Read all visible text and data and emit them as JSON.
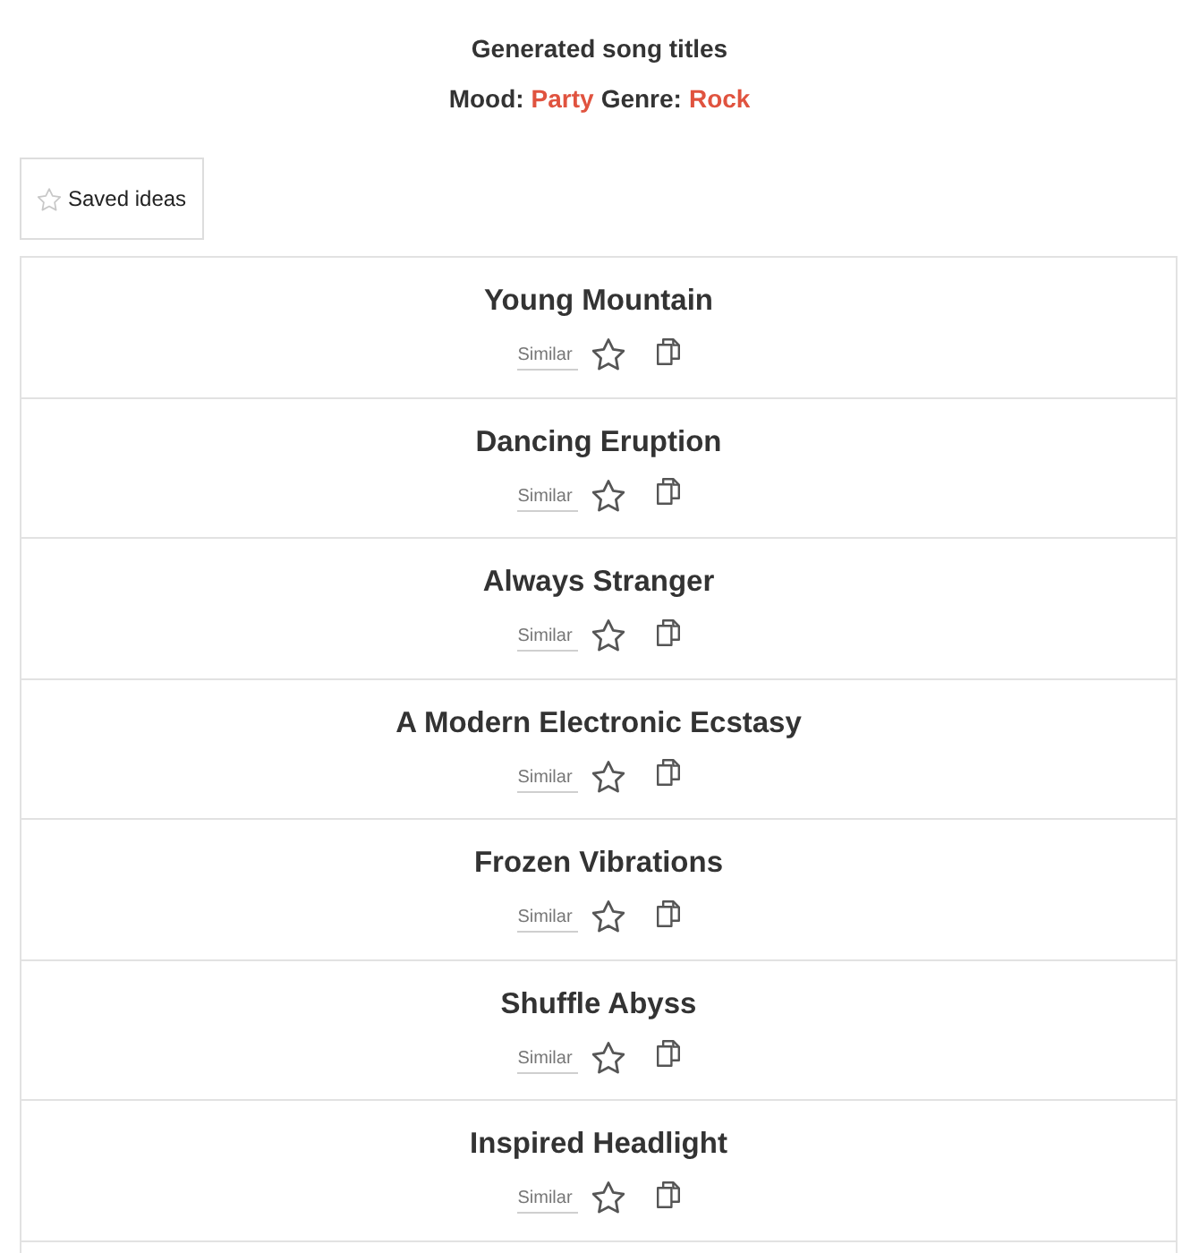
{
  "header": {
    "title": "Generated song titles",
    "filters": [
      {
        "label": "Mood:",
        "value": "Party"
      },
      {
        "label": "Genre:",
        "value": "Rock"
      }
    ]
  },
  "saved_button": {
    "label": "Saved ideas"
  },
  "songs": [
    {
      "title": "Young Mountain",
      "similar": "Similar",
      "saved": false
    },
    {
      "title": "Dancing Eruption",
      "similar": "Similar",
      "saved": false
    },
    {
      "title": "Always Stranger",
      "similar": "Similar",
      "saved": false
    },
    {
      "title": "A Modern Electronic Ecstasy",
      "similar": "Similar",
      "saved": false
    },
    {
      "title": "Frozen Vibrations",
      "similar": "Similar",
      "saved": false
    },
    {
      "title": "Shuffle Abyss",
      "similar": "Similar",
      "saved": false
    },
    {
      "title": "Inspired Headlight",
      "similar": "Similar",
      "saved": false
    }
  ]
}
